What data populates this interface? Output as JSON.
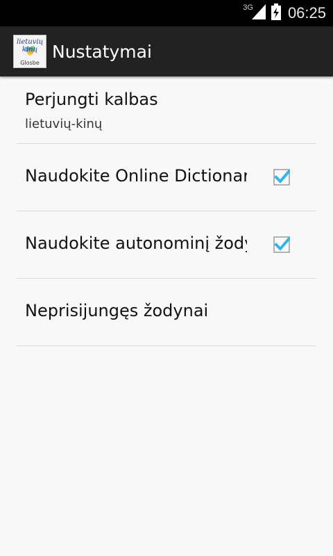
{
  "status_bar": {
    "network_label": "3G",
    "time": "06:25"
  },
  "action_bar": {
    "icon_text_line1": "lietuvių",
    "icon_text_line2": "kinų",
    "icon_text_line3": "Glosbe",
    "title": "Nustatymai"
  },
  "preferences": [
    {
      "title": "Perjungti kalbas",
      "summary": "lietuvių-kinų"
    },
    {
      "title": "Naudokite Online Dictionary",
      "checked": true
    },
    {
      "title": "Naudokite autonominį žodyną",
      "checked": true
    },
    {
      "title": "Neprisijungęs žodynai"
    }
  ],
  "colors": {
    "checkbox_check": "#33b5e5",
    "background": "#f8f8f8",
    "action_bar": "#222222"
  }
}
